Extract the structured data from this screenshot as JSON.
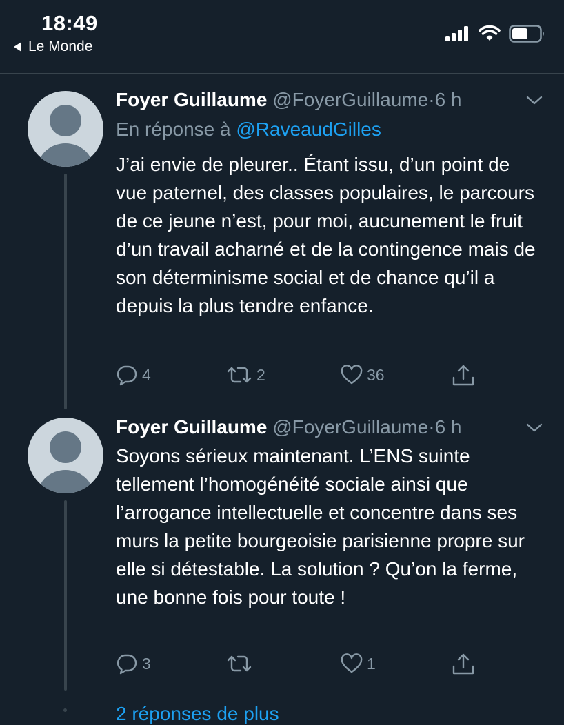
{
  "status_bar": {
    "time": "18:49",
    "back_app": "Le Monde"
  },
  "tweets": [
    {
      "name": "Foyer Guillaume",
      "handle": "@FoyerGuillaume",
      "separator": "·",
      "time": "6 h",
      "reply_prefix": "En réponse à",
      "reply_to": "@RaveaudGilles",
      "text": "J’ai envie de pleurer.. Étant issu, d’un point de vue paternel, des classes populaires, le parcours de ce jeune n’est, pour moi, aucunement le fruit d’un travail acharné et de la contingence mais de son déterminisme social et de chance qu’il a depuis la plus tendre enfance.",
      "replies": "4",
      "retweets": "2",
      "likes": "36"
    },
    {
      "name": "Foyer Guillaume",
      "handle": "@FoyerGuillaume",
      "separator": "·",
      "time": "6 h",
      "text": "Soyons sérieux maintenant. L’ENS suinte tellement l’homogénéité sociale ainsi que l’arrogance intellectuelle et concentre dans ses murs la petite bourgeoisie parisienne propre sur elle si détestable. La solution ? Qu’on la ferme, une bonne fois pour toute !",
      "replies": "3",
      "retweets": "",
      "likes": "1"
    }
  ],
  "more_replies": "2 réponses de plus",
  "colors": {
    "background": "#15202b",
    "secondary_text": "#8899a6",
    "accent": "#1da1f2",
    "divider": "#38444d"
  }
}
